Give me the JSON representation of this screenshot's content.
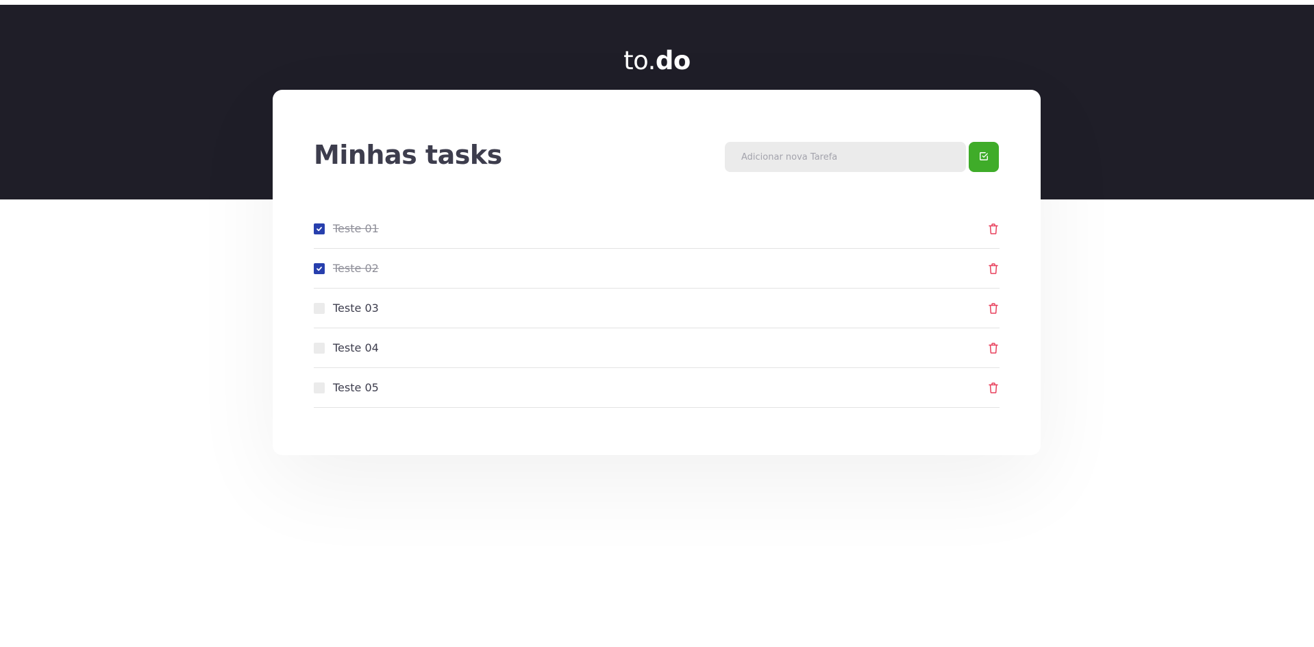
{
  "header": {
    "logo_light": "to.",
    "logo_bold": "do"
  },
  "main": {
    "title": "Minhas tasks",
    "new_task_placeholder": "Adicionar nova Tarefa",
    "add_button_icon": "check-square-icon"
  },
  "tasks": [
    {
      "label": "Teste 01",
      "done": true
    },
    {
      "label": "Teste 02",
      "done": true
    },
    {
      "label": "Teste 03",
      "done": false
    },
    {
      "label": "Teste 04",
      "done": false
    },
    {
      "label": "Teste 05",
      "done": false
    }
  ],
  "colors": {
    "header_bg": "#1f1e28",
    "accent_green": "#3fac29",
    "checkbox_blue": "#273fad",
    "trash_red": "#e83f5b"
  },
  "icons": {
    "trash": "trash-icon",
    "check": "checkmark-icon"
  }
}
